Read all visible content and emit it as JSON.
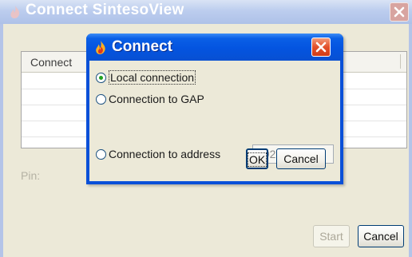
{
  "background_window": {
    "title": "Connect SintesoView",
    "table_header": "Connect",
    "pin_label": "Pin:",
    "start_label": "Start",
    "cancel_label": "Cancel"
  },
  "dialog": {
    "title": "Connect",
    "options": [
      {
        "label": "Local connection",
        "checked": true
      },
      {
        "label": "Connection to GAP",
        "checked": false
      },
      {
        "label": "Connection to address",
        "checked": false
      }
    ],
    "address_value": "192.168.1.1",
    "ok_label": "OK",
    "cancel_label": "Cancel"
  },
  "icons": {
    "app": "flame-icon",
    "close": "close-icon"
  },
  "colors": {
    "titlebar_active": "#0454e0",
    "close_button": "#e2502b",
    "dialog_face": "#ece9d8",
    "radio_dot": "#21a121"
  }
}
